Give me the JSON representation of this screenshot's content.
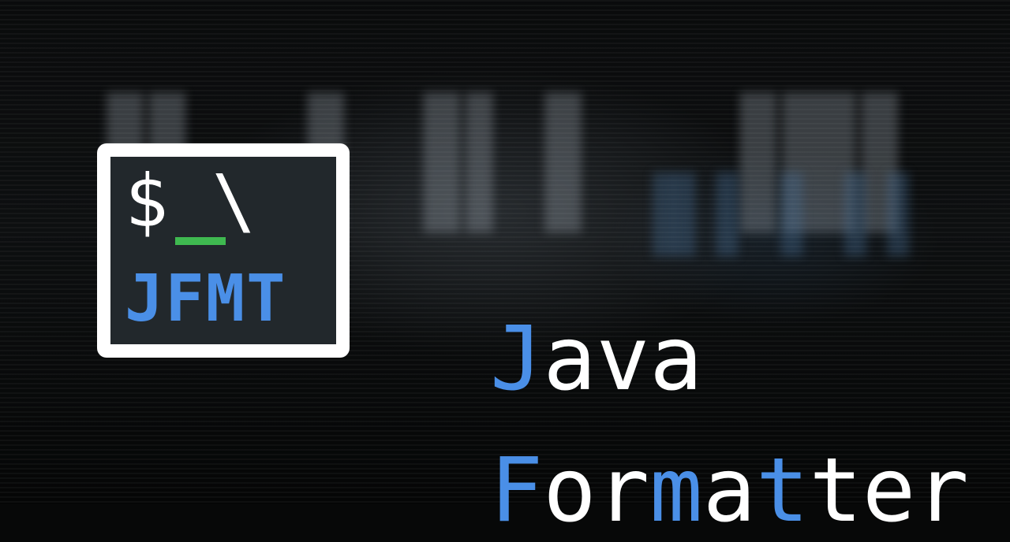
{
  "logo": {
    "prompt_text": "$ \\",
    "badge_text": "JFMT",
    "colors": {
      "frame": "#ffffff",
      "panel": "#22282c",
      "cursor": "#3fb950",
      "badge": "#4a8fe7"
    }
  },
  "title": {
    "line1": [
      {
        "text": "J",
        "color": "blue"
      },
      {
        "text": "ava",
        "color": "white"
      }
    ],
    "line2": [
      {
        "text": "F",
        "color": "blue"
      },
      {
        "text": "or",
        "color": "white"
      },
      {
        "text": "m",
        "color": "blue"
      },
      {
        "text": "a",
        "color": "white"
      },
      {
        "text": "t",
        "color": "blue"
      },
      {
        "text": "ter",
        "color": "white"
      }
    ],
    "accent": "#4a8fe7"
  }
}
